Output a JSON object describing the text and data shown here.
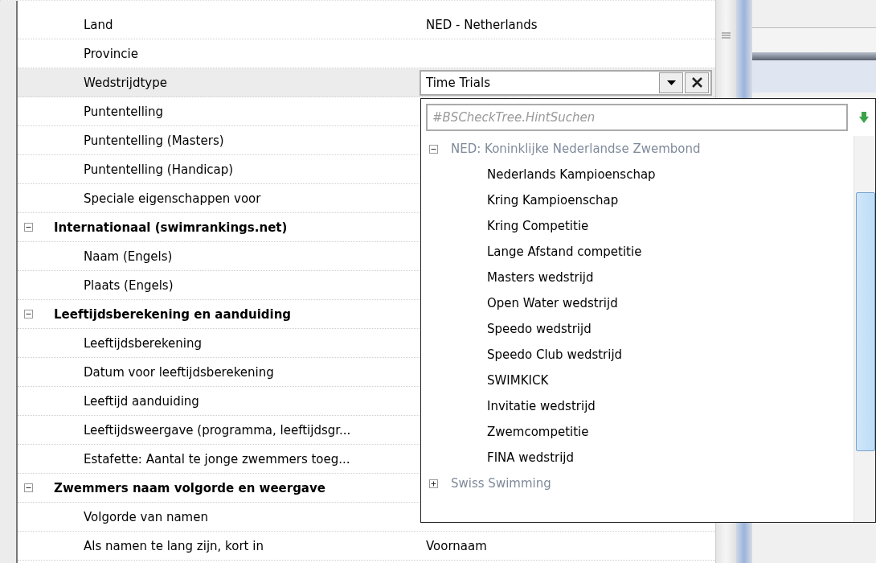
{
  "grid": {
    "rows": [
      {
        "kind": "property",
        "name": "Land",
        "value": "NED - Netherlands",
        "selected": false
      },
      {
        "kind": "property",
        "name": "Provincie",
        "selected": false
      },
      {
        "kind": "property",
        "name": "Wedstrijdtype",
        "selected": true,
        "editor": {
          "value": "Time Trials"
        }
      },
      {
        "kind": "property",
        "name": "Puntentelling",
        "selected": false
      },
      {
        "kind": "property",
        "name": "Puntentelling (Masters)",
        "selected": false
      },
      {
        "kind": "property",
        "name": "Puntentelling (Handicap)",
        "selected": false
      },
      {
        "kind": "property",
        "name": "Speciale eigenschappen voor",
        "selected": false
      },
      {
        "kind": "category",
        "name": "Internationaal (swimrankings.net)",
        "expanded": true
      },
      {
        "kind": "property",
        "name": "Naam (Engels)",
        "selected": false
      },
      {
        "kind": "property",
        "name": "Plaats (Engels)",
        "selected": false
      },
      {
        "kind": "category",
        "name": "Leeftijdsberekening en aanduiding",
        "expanded": true
      },
      {
        "kind": "property",
        "name": "Leeftijdsberekening",
        "selected": false
      },
      {
        "kind": "property",
        "name": "Datum voor leeftijdsberekening",
        "selected": false
      },
      {
        "kind": "property",
        "name": "Leeftijd aanduiding",
        "selected": false
      },
      {
        "kind": "property",
        "name": "Leeftijdsweergave (programma, leeftijdsgr...",
        "selected": false
      },
      {
        "kind": "property",
        "name": "Estafette: Aantal te jonge zwemmers toeg...",
        "selected": false
      },
      {
        "kind": "category",
        "name": "Zwemmers naam volgorde en weergave",
        "expanded": true
      },
      {
        "kind": "property",
        "name": "Volgorde van namen",
        "selected": false
      },
      {
        "kind": "property",
        "name": "Als namen te lang zijn, kort in",
        "value": "Voornaam",
        "selected": false
      }
    ]
  },
  "dropdown": {
    "search": {
      "placeholder": "#BSCheckTree.HintSuchen"
    },
    "tree": [
      {
        "label": "NED: Koninklijke Nederlandse Zwembond",
        "expanded": true,
        "children": [
          {
            "label": "Nederlands Kampioenschap"
          },
          {
            "label": "Kring Kampioenschap"
          },
          {
            "label": "Kring Competitie"
          },
          {
            "label": "Lange Afstand competitie"
          },
          {
            "label": "Masters wedstrijd"
          },
          {
            "label": "Open Water wedstrijd"
          },
          {
            "label": "Speedo wedstrijd"
          },
          {
            "label": "Speedo Club wedstrijd"
          },
          {
            "label": "SWIMKICK"
          },
          {
            "label": "Invitatie wedstrijd"
          },
          {
            "label": "Zwemcompetitie"
          },
          {
            "label": "FINA wedstrijd"
          }
        ]
      },
      {
        "label": "Swiss Swimming",
        "expanded": false
      }
    ]
  }
}
